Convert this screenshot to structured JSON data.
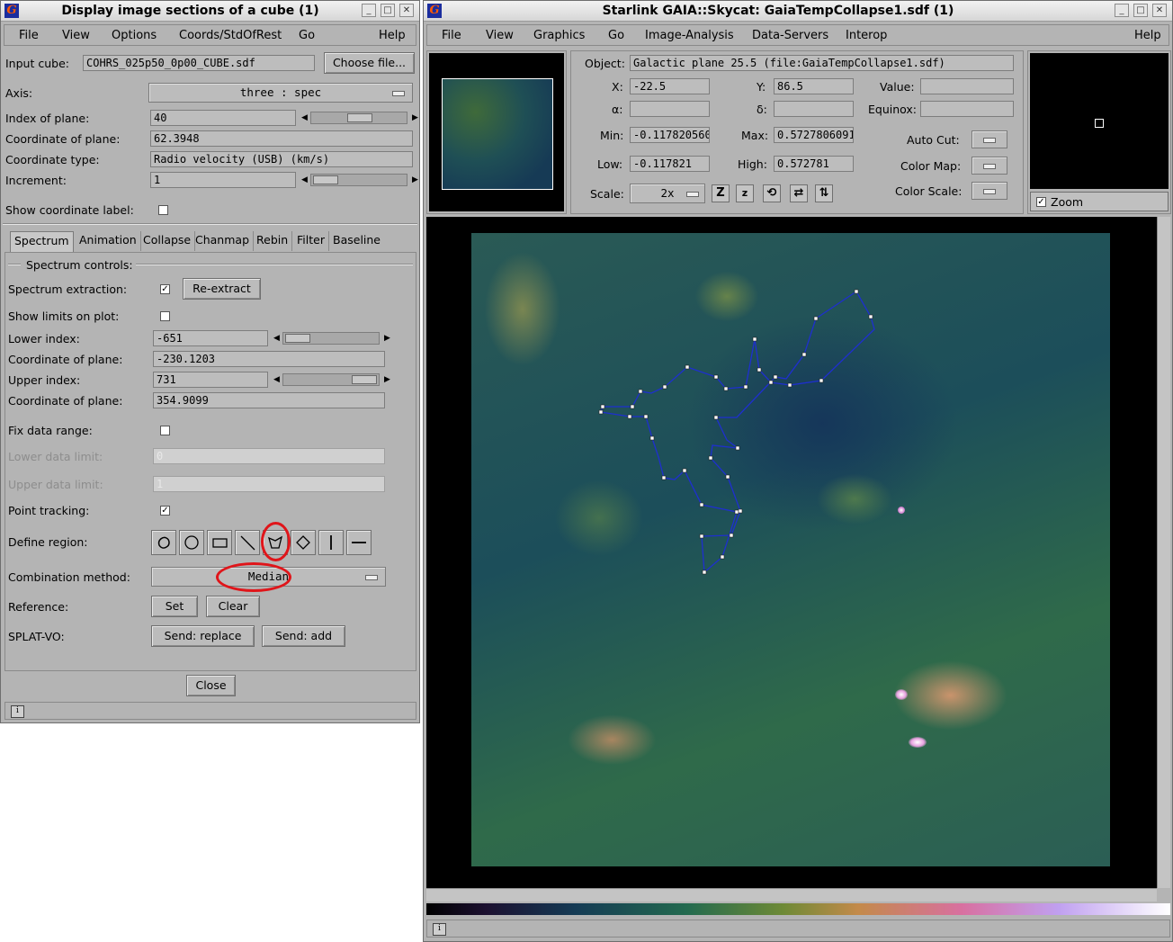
{
  "left": {
    "title": "Display image sections of a cube (1)",
    "menus": [
      "File",
      "View",
      "Options",
      "Coords/StdOfRest",
      "Go",
      "Help"
    ],
    "input_cube_label": "Input cube:",
    "input_cube_value": "COHRS_025p50_0p00_CUBE.sdf",
    "choose_file": "Choose file...",
    "axis_label": "Axis:",
    "axis_value": "three  :  spec",
    "index_label": "Index of plane:",
    "index_value": "40",
    "coord_label": "Coordinate of plane:",
    "coord_value": "62.3948",
    "coord_type_label": "Coordinate type:",
    "coord_type_value": "Radio velocity (USB) (km/s)",
    "increment_label": "Increment:",
    "increment_value": "1",
    "show_coord_label": "Show coordinate label:",
    "tabs": [
      "Spectrum",
      "Animation",
      "Collapse",
      "Chanmap",
      "Rebin",
      "Filter",
      "Baseline"
    ],
    "spectrum": {
      "heading": "Spectrum controls:",
      "extraction_label": "Spectrum extraction:",
      "reextract": "Re-extract",
      "show_limits": "Show limits on plot:",
      "lower_index_label": "Lower index:",
      "lower_index_value": "-651",
      "coord1_label": "Coordinate of plane:",
      "coord1_value": "-230.1203",
      "upper_index_label": "Upper index:",
      "upper_index_value": "731",
      "coord2_label": "Coordinate of plane:",
      "coord2_value": "354.9099",
      "fix_range": "Fix data range:",
      "lower_limit": "Lower data limit:",
      "lower_limit_value": "0",
      "upper_limit": "Upper data limit:",
      "upper_limit_value": "1",
      "point_tracking": "Point tracking:",
      "define_region": "Define region:",
      "combination_label": "Combination method:",
      "combination_value": "Median",
      "reference_label": "Reference:",
      "set": "Set",
      "clear": "Clear",
      "splat_label": "SPLAT-VO:",
      "send_replace": "Send: replace",
      "send_add": "Send: add"
    },
    "close": "Close"
  },
  "right": {
    "title": "Starlink GAIA::Skycat: GaiaTempCollapse1.sdf (1)",
    "menus": [
      "File",
      "View",
      "Graphics",
      "Go",
      "Image-Analysis",
      "Data-Servers",
      "Interop",
      "Help"
    ],
    "object_label": "Object:",
    "object_value": "Galactic plane 25.5 (file:GaiaTempCollapse1.sdf)",
    "x_label": "X:",
    "x_value": "-22.5",
    "y_label": "Y:",
    "y_value": "86.5",
    "value_label": "Value:",
    "value_value": "",
    "alpha_label": "α:",
    "alpha_value": "",
    "delta_label": "δ:",
    "delta_value": "",
    "equinox_label": "Equinox:",
    "equinox_value": "",
    "min_label": "Min:",
    "min_value": "-0.117820560",
    "max_label": "Max:",
    "max_value": "0.5727806091",
    "low_label": "Low:",
    "low_value": "-0.117821",
    "high_label": "High:",
    "high_value": "0.572781",
    "autocut_label": "Auto Cut:",
    "colormap_label": "Color Map:",
    "colorscale_label": "Color Scale:",
    "scale_label": "Scale:",
    "scale_value": "2x",
    "zoom_label": "Zoom"
  }
}
